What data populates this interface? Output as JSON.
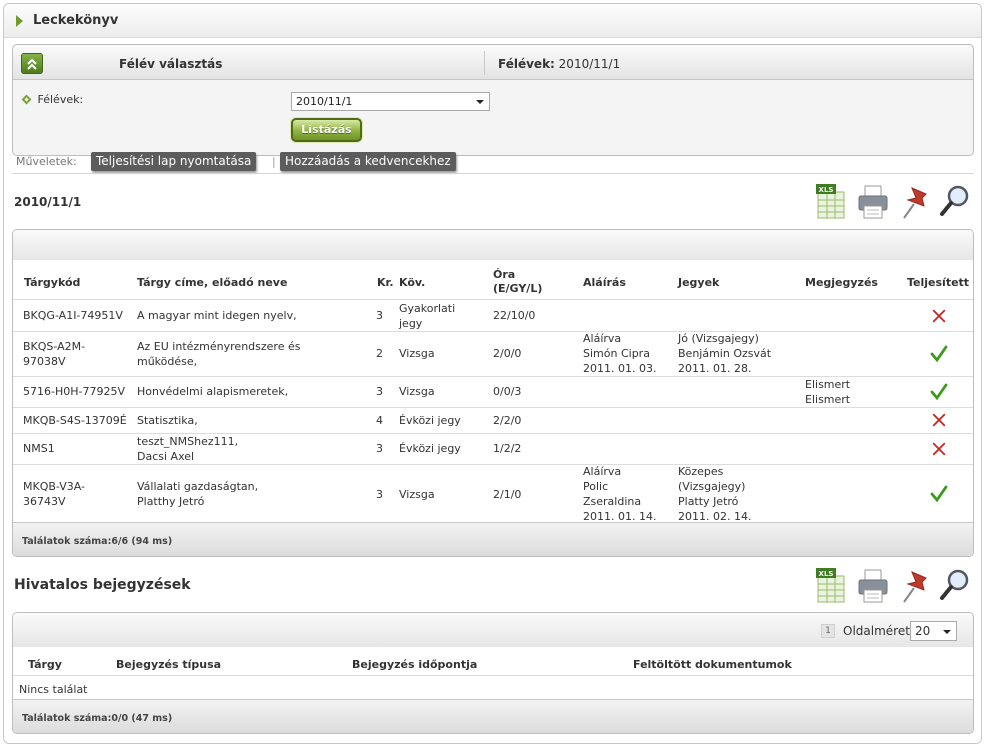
{
  "window": {
    "title": "Leckekönyv"
  },
  "semester_panel": {
    "heading": "Félév választás",
    "current_label": "Félévek:",
    "current_value": "2010/11/1",
    "field_label": "Félévek:",
    "selected": "2010/11/1",
    "submit_label": "Listázás"
  },
  "actions": {
    "label": "Műveletek:",
    "print_label": "Teljesítési lap nyomtatása",
    "fav_label": "Hozzáadás a kedvencekhez",
    "separator": "|"
  },
  "toolbar_icons": [
    "excel-export-icon",
    "print-icon",
    "pin-icon",
    "search-icon"
  ],
  "courses": {
    "section_title": "2010/11/1",
    "columns": {
      "code": "Tárgykód",
      "name": "Tárgy címe, előadó neve",
      "credit": "Kr.",
      "req": "Köv.",
      "hours_1": "Óra",
      "hours_2": "(E/GY/L)",
      "signature": "Aláírás",
      "grades": "Jegyek",
      "note": "Megjegyzés",
      "done": "Teljesített"
    },
    "rows": [
      {
        "code": [
          "BKQG-A1I-74951V"
        ],
        "name": [
          "A magyar mint idegen nyelv,"
        ],
        "credit": "3",
        "req": [
          "Gyakorlati",
          "jegy"
        ],
        "hours": "22/10/0",
        "signature": [],
        "grades": [],
        "note": [],
        "done": false
      },
      {
        "code": [
          "BKQS-A2M-",
          "97038V"
        ],
        "name": [
          "Az EU intézményrendszere és",
          "működése,"
        ],
        "credit": "2",
        "req": [
          "Vizsga"
        ],
        "hours": "2/0/0",
        "signature": [
          "Aláírva",
          "Simón Cipra",
          "2011. 01. 03."
        ],
        "grades": [
          "Jó (Vizsgajegy)",
          "Benjámin Ozsvát",
          "2011. 01. 28."
        ],
        "note": [],
        "done": true
      },
      {
        "code": [
          "5716-H0H-77925V"
        ],
        "name": [
          "Honvédelmi alapismeretek,"
        ],
        "credit": "3",
        "req": [
          "Vizsga"
        ],
        "hours": "0/0/3",
        "signature": [],
        "grades": [],
        "note": [
          "Elismert",
          "Elismert"
        ],
        "done": true
      },
      {
        "code": [
          "MKQB-S4S-13709É"
        ],
        "name": [
          "Statisztika,"
        ],
        "credit": "4",
        "req": [
          "Évközi jegy"
        ],
        "hours": "2/2/0",
        "signature": [],
        "grades": [],
        "note": [],
        "done": false
      },
      {
        "code": [
          "NMS1"
        ],
        "name": [
          "teszt_NMShez111,",
          "Dacsi Axel"
        ],
        "credit": "3",
        "req": [
          "Évközi jegy"
        ],
        "hours": "1/2/2",
        "signature": [],
        "grades": [],
        "note": [],
        "done": false
      },
      {
        "code": [
          "MKQB-V3A-",
          "36743V"
        ],
        "name": [
          "Vállalati gazdaságtan,",
          "Platthy Jetró"
        ],
        "credit": "3",
        "req": [
          "Vizsga"
        ],
        "hours": "2/1/0",
        "signature": [
          "Aláírva",
          "Polic",
          "Zseraldina",
          "2011. 01. 14."
        ],
        "grades": [
          "Közepes",
          "(Vizsgajegy)",
          "Platty Jetró",
          "2011. 02. 14."
        ],
        "note": [],
        "done": true
      }
    ],
    "footer": "Találatok száma:6/6 (94 ms)"
  },
  "official": {
    "section_title": "Hivatalos bejegyzések",
    "pager": {
      "page": "1",
      "page_size_label": "Oldalméret",
      "page_size": "20"
    },
    "columns": {
      "subject": "Tárgy",
      "type": "Bejegyzés típusa",
      "time": "Bejegyzés időpontja",
      "docs": "Feltöltött dokumentumok"
    },
    "empty_text": "Nincs találat",
    "footer": "Találatok száma:0/0 (47 ms)"
  },
  "colors": {
    "accent_green": "#6e9a2e",
    "ok_green": "#3a9a1a",
    "fail_red": "#cc2222"
  }
}
